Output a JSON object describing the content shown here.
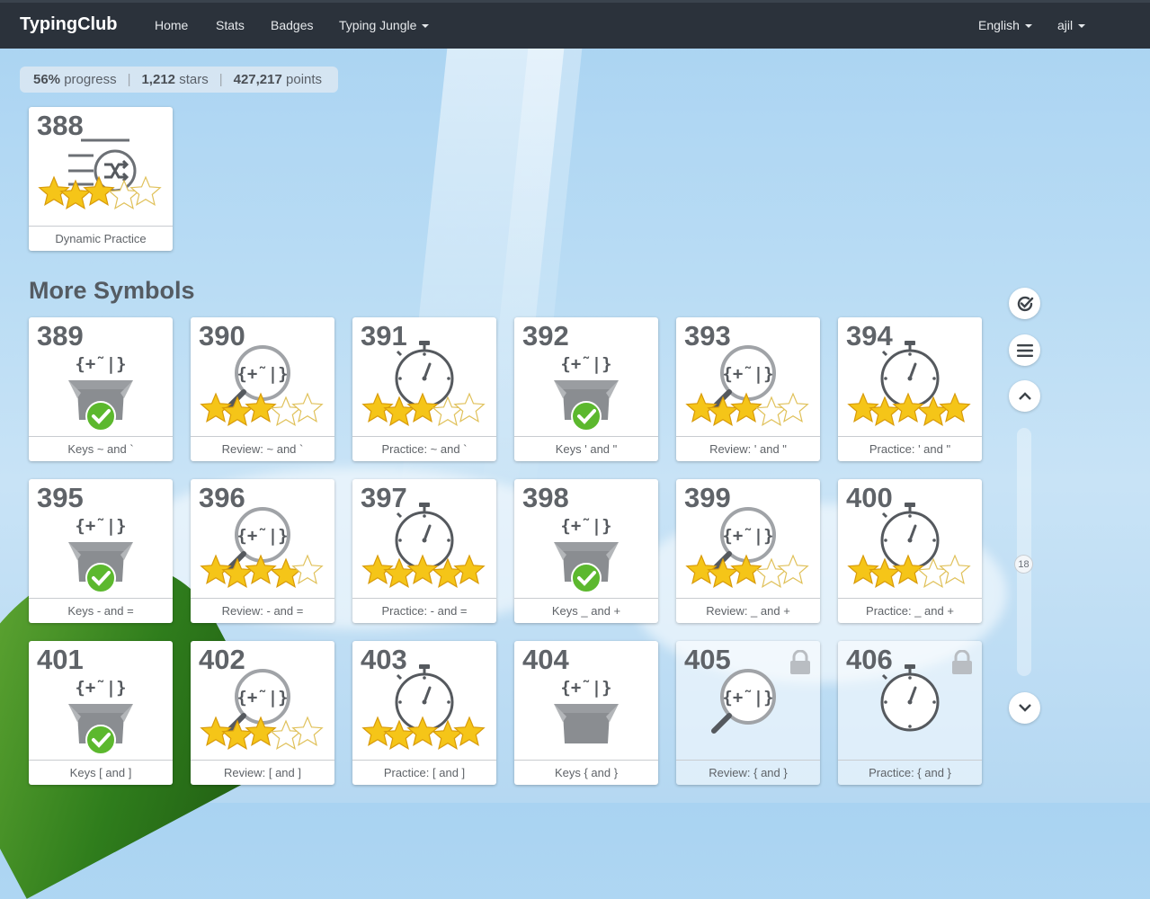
{
  "navbar": {
    "brand": "TypingClub",
    "links": [
      "Home",
      "Stats",
      "Badges"
    ],
    "jungle_label": "Typing Jungle",
    "language_label": "English",
    "user_label": "ajil"
  },
  "stats": {
    "progress_value": "56%",
    "progress_label": "progress",
    "stars_value": "1,212",
    "stars_label": "stars",
    "points_value": "427,217",
    "points_label": "points"
  },
  "top_card": {
    "number": "388",
    "label": "Dynamic Practice",
    "type": "dynamic",
    "stars": 3
  },
  "section_title": "More Symbols",
  "lessons": [
    {
      "number": "389",
      "label": "Keys ~ and `",
      "type": "keys",
      "done": true,
      "stars": 0,
      "locked": false
    },
    {
      "number": "390",
      "label": "Review: ~ and `",
      "type": "review",
      "done": false,
      "stars": 3,
      "locked": false
    },
    {
      "number": "391",
      "label": "Practice: ~ and `",
      "type": "practice",
      "done": false,
      "stars": 3,
      "locked": false
    },
    {
      "number": "392",
      "label": "Keys ' and \"",
      "type": "keys",
      "done": true,
      "stars": 0,
      "locked": false
    },
    {
      "number": "393",
      "label": "Review: ' and \"",
      "type": "review",
      "done": false,
      "stars": 3,
      "locked": false
    },
    {
      "number": "394",
      "label": "Practice: ' and \"",
      "type": "practice",
      "done": false,
      "stars": 5,
      "locked": false
    },
    {
      "number": "395",
      "label": "Keys - and =",
      "type": "keys",
      "done": true,
      "stars": 0,
      "locked": false
    },
    {
      "number": "396",
      "label": "Review: - and =",
      "type": "review",
      "done": false,
      "stars": 4,
      "locked": false
    },
    {
      "number": "397",
      "label": "Practice: - and =",
      "type": "practice",
      "done": false,
      "stars": 5,
      "locked": false
    },
    {
      "number": "398",
      "label": "Keys _ and +",
      "type": "keys",
      "done": true,
      "stars": 0,
      "locked": false
    },
    {
      "number": "399",
      "label": "Review: _ and +",
      "type": "review",
      "done": false,
      "stars": 3,
      "locked": false
    },
    {
      "number": "400",
      "label": "Practice: _ and +",
      "type": "practice",
      "done": false,
      "stars": 3,
      "locked": false
    },
    {
      "number": "401",
      "label": "Keys [ and ]",
      "type": "keys",
      "done": true,
      "stars": 0,
      "locked": false
    },
    {
      "number": "402",
      "label": "Review: [ and ]",
      "type": "review",
      "done": false,
      "stars": 3,
      "locked": false
    },
    {
      "number": "403",
      "label": "Practice: [ and ]",
      "type": "practice",
      "done": false,
      "stars": 5,
      "locked": false
    },
    {
      "number": "404",
      "label": "Keys { and }",
      "type": "keys",
      "done": false,
      "stars": 0,
      "locked": false
    },
    {
      "number": "405",
      "label": "Review: { and }",
      "type": "review",
      "done": false,
      "stars": 0,
      "locked": true
    },
    {
      "number": "406",
      "label": "Practice: { and }",
      "type": "practice",
      "done": false,
      "stars": 0,
      "locked": true
    }
  ],
  "scroll": {
    "position_label": "18"
  },
  "colors": {
    "navbar": "#2b323b",
    "star": "#f5c518",
    "check": "#5cb82e",
    "text": "#5f6368"
  }
}
